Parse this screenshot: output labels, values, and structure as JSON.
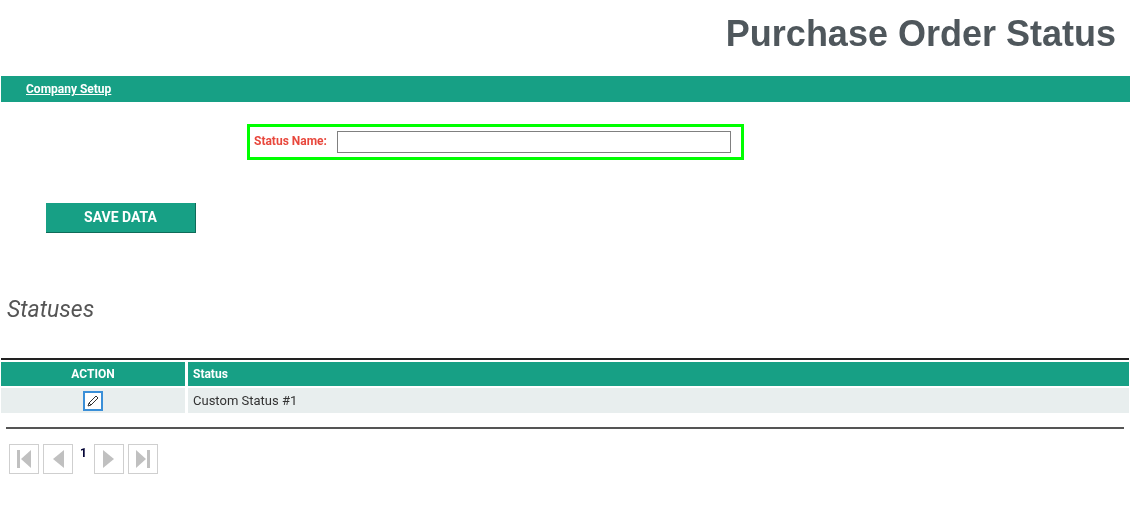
{
  "page_title": "Purchase Order Status",
  "nav": {
    "links": [
      "Company Setup"
    ]
  },
  "form": {
    "highlighted": true,
    "fields": [
      {
        "label": "Status Name:"
      }
    ]
  },
  "save_button": "SAVE DATA",
  "section_title": "Statuses",
  "table": {
    "columns": [
      "ACTION",
      "Status"
    ],
    "rows": [
      {
        "status": "Custom Status #1"
      }
    ]
  },
  "pager": {
    "current_page": "1"
  }
}
